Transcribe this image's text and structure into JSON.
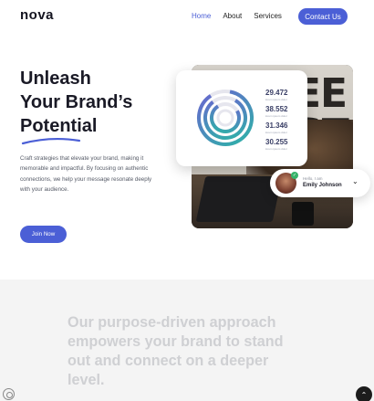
{
  "nav": {
    "logo": "nova",
    "links": [
      "Home",
      "About",
      "Services"
    ],
    "active": "Home",
    "cta": "Contact Us"
  },
  "hero": {
    "title_lines": [
      "Unleash",
      "Your Brand’s",
      "Potential"
    ],
    "description": "Craft strategies that elevate your brand, making it memorable and impactful. By focusing on authentic connections, we help your message resonate deeply with your audience.",
    "button": "Join Now"
  },
  "stats": [
    {
      "value": "29.472",
      "note": "lorem ipsum dolor"
    },
    {
      "value": "38.552",
      "note": "lorem ipsum dolor"
    },
    {
      "value": "31.346",
      "note": "lorem ipsum dolor"
    },
    {
      "value": "30.255",
      "note": "lorem ipsum dolor"
    }
  ],
  "profile": {
    "greeting": "Hello, I am",
    "name": "Emily Johnson"
  },
  "purpose": {
    "text": "Our purpose-driven approach empowers your brand to stand out and connect on a deeper level."
  },
  "colors": {
    "accent": "#4b5fd6",
    "ring_teal": "#2bb5a6",
    "ring_purple": "#6b63d1"
  },
  "icons": {
    "scroll_top": "arrow-up-icon",
    "fingerprint": "fingerprint-icon",
    "verified": "check-icon",
    "dropdown": "chevron-down-icon"
  }
}
